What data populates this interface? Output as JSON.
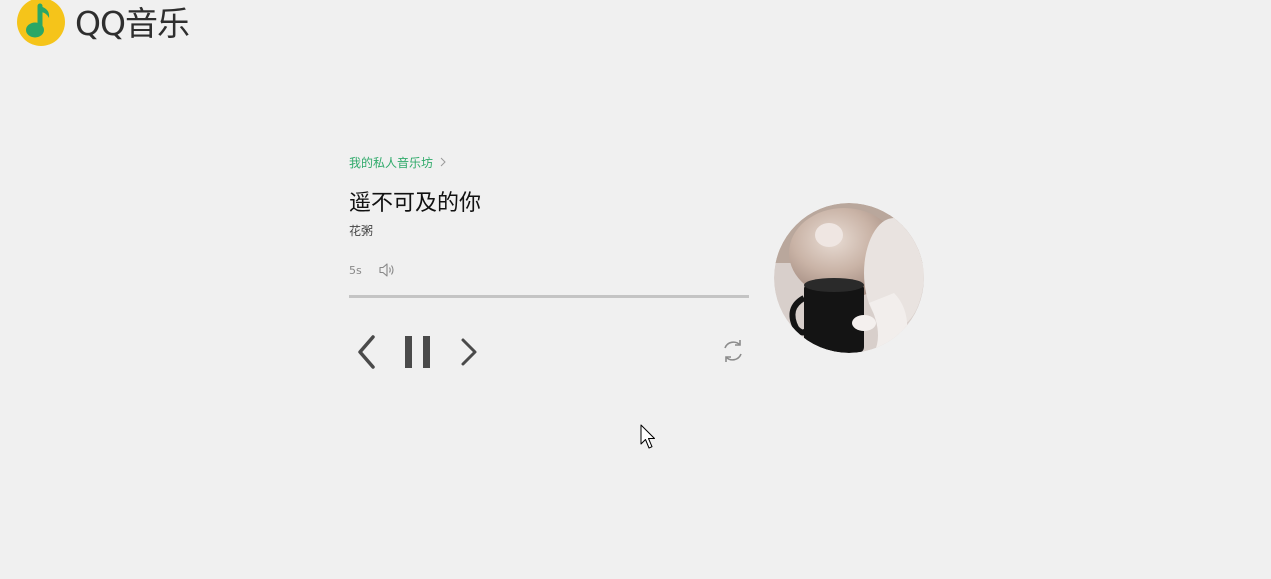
{
  "header": {
    "logo_text": "QQ音乐",
    "brand_colors": {
      "disc": "#f5c41a",
      "note": "#2aa766"
    }
  },
  "player": {
    "radio_link_label": "我的私人音乐坊",
    "song_title": "遥不可及的你",
    "artist": "花粥",
    "elapsed": "5s",
    "progress_fraction": 0.0,
    "accent_color": "#2faa6a",
    "controls": {
      "prev_icon": "chevron-left-icon",
      "pause_icon": "pause-icon",
      "next_icon": "chevron-right-icon",
      "loop_icon": "refresh-icon",
      "volume_icon": "speaker-icon"
    },
    "cover_art": "album-cover-cat"
  }
}
